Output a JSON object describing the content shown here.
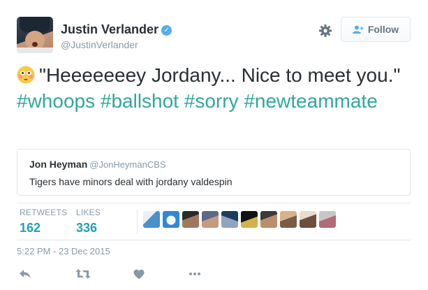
{
  "user": {
    "name": "Justin Verlander",
    "handle": "@JustinVerlander",
    "verified_glyph": "✓"
  },
  "follow_button": {
    "label": "Follow"
  },
  "tweet": {
    "emoji": "flushed-face-emoji",
    "text_before": "\"Heeeeeeey Jordany...   Nice to meet you.\"",
    "hashtags": [
      "#whoops",
      "#ballshot",
      "#sorry",
      "#newteammate"
    ]
  },
  "quoted_tweet": {
    "name": "Jon Heyman",
    "handle": "@JonHeymanCBS",
    "text": "Tigers have minors deal with jordany valdespin"
  },
  "stats": {
    "retweets_label": "RETWEETS",
    "retweets": "162",
    "likes_label": "LIKES",
    "likes": "336"
  },
  "timestamp": "5:22 PM - 23 Dec 2015",
  "colors": {
    "hashtag": "#31a79c",
    "stat_value": "#239fb8",
    "verified": "#55acee",
    "muted": "#8899a6"
  },
  "icons": [
    "gear-icon",
    "follow-person-icon",
    "reply-icon",
    "retweet-icon",
    "like-heart-icon",
    "more-icon"
  ]
}
